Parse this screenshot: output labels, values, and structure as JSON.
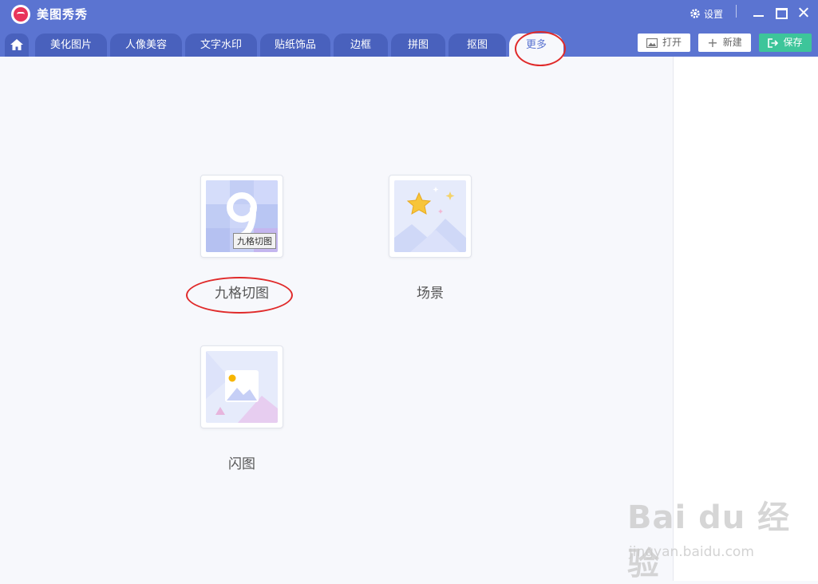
{
  "app": {
    "title": "美图秀秀"
  },
  "window": {
    "settings_label": "设置"
  },
  "tabs": [
    "美化图片",
    "人像美容",
    "文字水印",
    "贴纸饰品",
    "边框",
    "拼图",
    "抠图",
    "更多"
  ],
  "toolbar": {
    "open_label": "打开",
    "new_label": "新建",
    "save_label": "保存"
  },
  "tools": [
    {
      "label": "九格切图",
      "tooltip": "九格切图"
    },
    {
      "label": "场景"
    },
    {
      "label": "闪图"
    }
  ],
  "watermark": {
    "logo_text": "Bai du 经验",
    "url": "jingyan.baidu.com"
  },
  "colors": {
    "header": "#5b74d1",
    "tab_inactive": "#4961bd",
    "save_green": "#3dc59a",
    "annotation_red": "#e02a2a"
  }
}
